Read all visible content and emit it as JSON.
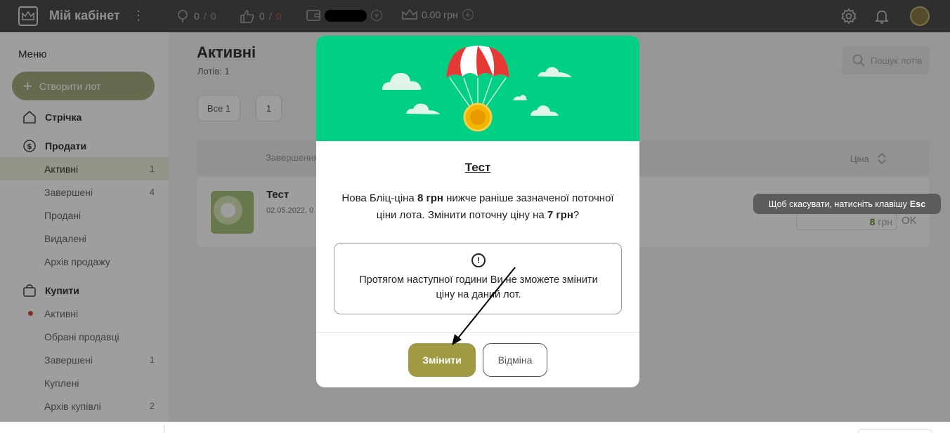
{
  "topbar": {
    "app_title": "Мій кабінет",
    "stat_likes_a": "0",
    "stat_likes_sep": "/",
    "stat_likes_b": "0",
    "stat_thumbs_a": "0",
    "stat_thumbs_sep": "/",
    "stat_thumbs_b": "0",
    "balance": "0.00 грн",
    "plus_glyph": "+"
  },
  "sidebar": {
    "menu_title": "Меню",
    "create_label": "Створити лот",
    "create_glyph": "+",
    "feed_label": "Стрічка",
    "sell_label": "Продати",
    "sell_items": [
      {
        "label": "Активні",
        "count": "1"
      },
      {
        "label": "Завершені",
        "count": "4"
      },
      {
        "label": "Продані",
        "count": ""
      },
      {
        "label": "Видалені",
        "count": ""
      },
      {
        "label": "Архів продажу",
        "count": ""
      }
    ],
    "buy_label": "Купити",
    "buy_items": [
      {
        "label": "Активні",
        "count": ""
      },
      {
        "label": "Обрані продавці",
        "count": ""
      },
      {
        "label": "Завершені",
        "count": "1"
      },
      {
        "label": "Куплені",
        "count": ""
      },
      {
        "label": "Архів купівлі",
        "count": "2"
      }
    ]
  },
  "main": {
    "page_title": "Активні",
    "lots_count": "Лотів: 1",
    "search_placeholder": "Пошук лотів",
    "chip_all": "Все 1",
    "chip_one": "1",
    "col_done": "Завершення",
    "col_price": "Ціна",
    "lot": {
      "name": "Тест",
      "date": "02.05.2022, 0",
      "price": "8",
      "currency": "грн",
      "ok": "OK"
    }
  },
  "tooltip": {
    "text": "Щоб скасувати, натисніть клавішу",
    "key": "Esc"
  },
  "modal": {
    "title": "Тест",
    "msg_part1": "Нова Бліц-ціна ",
    "msg_new_price": "8 грн",
    "msg_part2": " нижче раніше зазначеної поточної ціни лота. Змінити поточну ціну на ",
    "msg_cur_price": "7 грн",
    "msg_part3": "?",
    "notice_icon": "!",
    "notice_text": "Протягом наступної години Ви не зможете змінити ціну на даний лот.",
    "confirm_label": "Змінити",
    "cancel_label": "Відміна"
  },
  "colors": {
    "banner": "#00d084",
    "accent_olive": "#a09a42",
    "topbar": "#4d4d4d"
  }
}
